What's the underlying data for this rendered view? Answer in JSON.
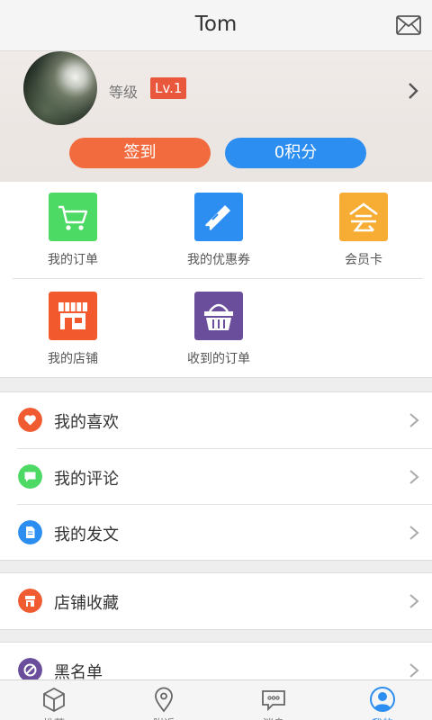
{
  "header": {
    "title": "Tom",
    "mail_icon": "mail-icon"
  },
  "profile": {
    "level_label": "等级",
    "level_badge": "Lv.1",
    "signin_label": "签到",
    "points_label": "0积分",
    "colors": {
      "signin": "#f26b3e",
      "points": "#2c8ef0",
      "badge": "#e9583c"
    }
  },
  "grid": {
    "items": [
      {
        "label": "我的订单",
        "icon": "cart-icon",
        "color": "#4cd964"
      },
      {
        "label": "我的优惠券",
        "icon": "ticket-icon",
        "color": "#2c8ef0"
      },
      {
        "label": "会员卡",
        "icon": "member-card-icon",
        "color": "#f7ac33"
      },
      {
        "label": "我的店铺",
        "icon": "store-icon",
        "color": "#f2592c"
      },
      {
        "label": "收到的订单",
        "icon": "basket-icon",
        "color": "#6a4d9b"
      }
    ]
  },
  "lists": {
    "group1": [
      {
        "label": "我的喜欢",
        "icon": "heart-icon",
        "color": "#f05b32"
      },
      {
        "label": "我的评论",
        "icon": "comment-icon",
        "color": "#4cd964"
      },
      {
        "label": "我的发文",
        "icon": "document-icon",
        "color": "#2c8ef0"
      }
    ],
    "group2": [
      {
        "label": "店铺收藏",
        "icon": "store-favorite-icon",
        "color": "#f05b32"
      }
    ],
    "group3": [
      {
        "label": "黑名单",
        "icon": "blacklist-icon",
        "color": "#6a4d9b"
      }
    ]
  },
  "bottom_nav": {
    "items": [
      {
        "label": "推荐",
        "icon": "cube-icon"
      },
      {
        "label": "附近",
        "icon": "location-icon"
      },
      {
        "label": "消息",
        "icon": "message-icon"
      },
      {
        "label": "我的",
        "icon": "profile-icon",
        "active": true
      }
    ],
    "active_color": "#2c8ef0"
  }
}
